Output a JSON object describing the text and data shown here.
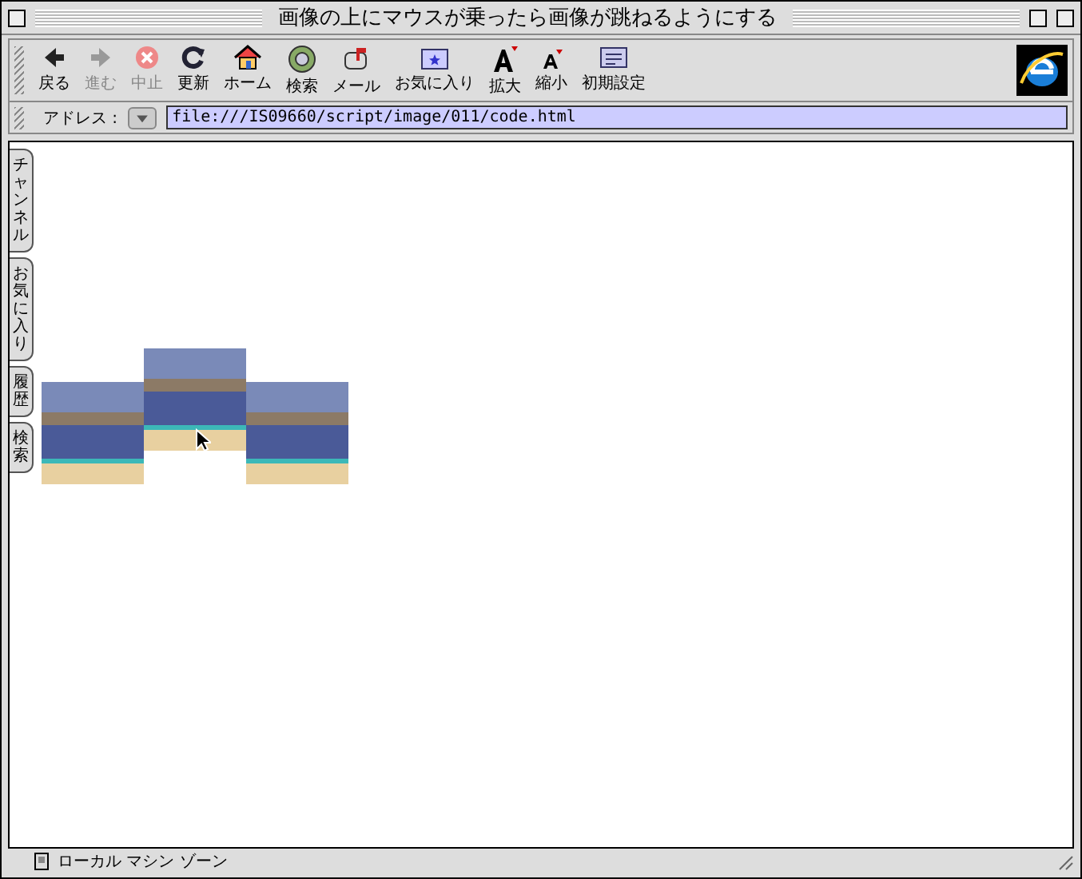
{
  "window": {
    "title": "画像の上にマウスが乗ったら画像が跳ねるようにする"
  },
  "toolbar": [
    {
      "label": "戻る",
      "kind": "back",
      "disabled": false
    },
    {
      "label": "進む",
      "kind": "forward",
      "disabled": true
    },
    {
      "label": "中止",
      "kind": "stop",
      "disabled": true
    },
    {
      "label": "更新",
      "kind": "refresh",
      "disabled": false
    },
    {
      "label": "ホーム",
      "kind": "home",
      "disabled": false
    },
    {
      "label": "検索",
      "kind": "search",
      "disabled": false
    },
    {
      "label": "メール",
      "kind": "mail",
      "disabled": false
    },
    {
      "label": "お気に入り",
      "kind": "favorites",
      "disabled": false
    },
    {
      "label": "拡大",
      "kind": "larger",
      "disabled": false
    },
    {
      "label": "縮小",
      "kind": "smaller",
      "disabled": false
    },
    {
      "label": "初期設定",
      "kind": "prefs",
      "disabled": false
    }
  ],
  "address_bar": {
    "label": "アドレス :",
    "value": "file:///IS09660/script/image/011/code.html"
  },
  "side_tabs": [
    {
      "label": "チャンネル"
    },
    {
      "label": "お気に入り"
    },
    {
      "label": "履歴"
    },
    {
      "label": "検索"
    }
  ],
  "images": [
    {
      "raised": false
    },
    {
      "raised": true,
      "hovered": true
    },
    {
      "raised": false
    }
  ],
  "status_bar": {
    "zone": "ローカル マシン ゾーン"
  }
}
